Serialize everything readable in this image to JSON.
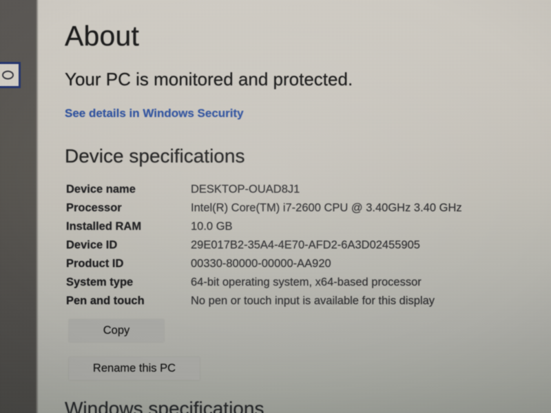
{
  "page": {
    "title": "About",
    "status_text": "Your PC is monitored and protected.",
    "status_link": "See details in Windows Security"
  },
  "device_specifications": {
    "section_title": "Device specifications",
    "rows": [
      {
        "label": "Device name",
        "value": "DESKTOP-OUAD8J1"
      },
      {
        "label": "Processor",
        "value": "Intel(R) Core(TM) i7-2600 CPU @ 3.40GHz   3.40 GHz"
      },
      {
        "label": "Installed RAM",
        "value": "10.0 GB"
      },
      {
        "label": "Device ID",
        "value": "29E017B2-35A4-4E70-AFD2-6A3D02455905"
      },
      {
        "label": "Product ID",
        "value": "00330-80000-00000-AA920"
      },
      {
        "label": "System type",
        "value": "64-bit operating system, x64-based processor"
      },
      {
        "label": "Pen and touch",
        "value": "No pen or touch input is available for this display"
      }
    ],
    "copy_button": "Copy",
    "rename_button": "Rename this PC"
  },
  "windows_specifications": {
    "section_title": "Windows specifications"
  },
  "colors": {
    "link": "#2b4f9e",
    "text": "#1b1b1b",
    "button_background": "#a9a9a5",
    "left_strip": "#55524f",
    "edge_control_border": "#24356f"
  }
}
